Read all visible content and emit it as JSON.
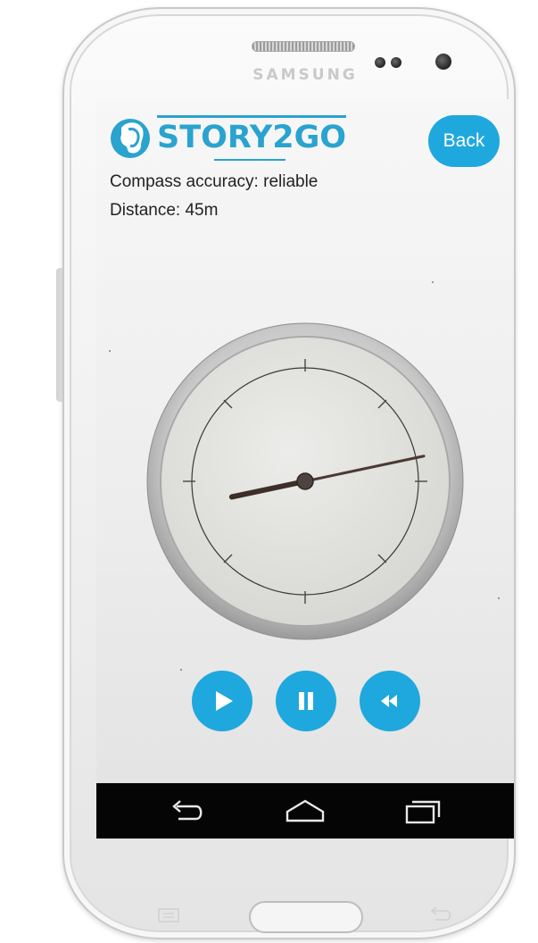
{
  "device": {
    "brand": "SAMSUNG"
  },
  "app": {
    "logo_text": "STORY2GO",
    "back_label": "Back"
  },
  "status": {
    "compass_accuracy": "Compass accuracy: reliable",
    "distance": "Distance: 45m"
  },
  "compass": {
    "needle_bearing_deg": 78
  },
  "controls": [
    {
      "name": "play-button",
      "icon": "play-icon"
    },
    {
      "name": "pause-button",
      "icon": "pause-icon"
    },
    {
      "name": "rewind-button",
      "icon": "rewind-icon"
    }
  ],
  "nav_bar": [
    {
      "name": "back-nav-button",
      "icon": "back-arrow-icon"
    },
    {
      "name": "home-nav-button",
      "icon": "home-icon"
    },
    {
      "name": "recent-apps-button",
      "icon": "recent-apps-icon"
    }
  ],
  "colors": {
    "accent": "#1fa8de",
    "logo_blue": "#2aa3cf",
    "nav_bar": "#050505",
    "needle": "#4a3a33"
  }
}
